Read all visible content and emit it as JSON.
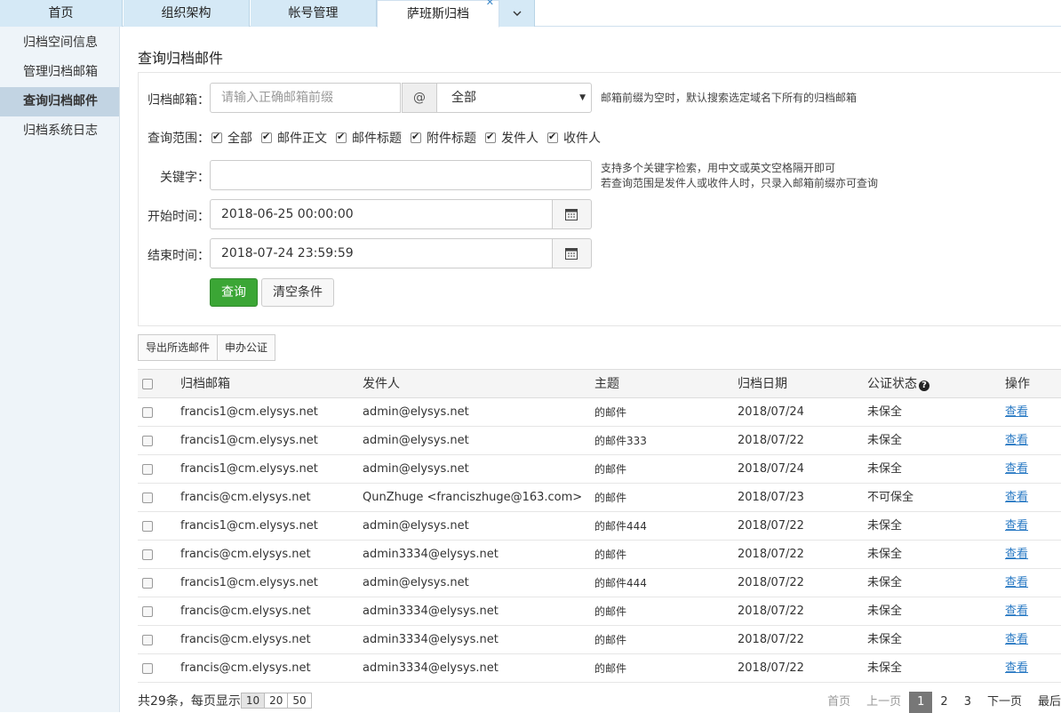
{
  "tabs": [
    {
      "label": "首页"
    },
    {
      "label": "组织架构"
    },
    {
      "label": "帐号管理"
    },
    {
      "label": "萨班斯归档"
    }
  ],
  "sidebar": {
    "items": [
      {
        "label": "归档空间信息"
      },
      {
        "label": "管理归档邮箱"
      },
      {
        "label": "查询归档邮件"
      },
      {
        "label": "归档系统日志"
      }
    ]
  },
  "page_title": "查询归档邮件",
  "form": {
    "mailbox_label": "归档邮箱：",
    "mailbox_placeholder": "请输入正确邮箱前缀",
    "at_symbol": "@",
    "domain_selected": "全部",
    "mailbox_hint": "邮箱前缀为空时，默认搜索选定域名下所有的归档邮箱",
    "scope_label": "查询范围：",
    "scope_options": [
      {
        "label": "全部",
        "checked": true
      },
      {
        "label": "邮件正文",
        "checked": true
      },
      {
        "label": "邮件标题",
        "checked": true
      },
      {
        "label": "附件标题",
        "checked": true
      },
      {
        "label": "发件人",
        "checked": true
      },
      {
        "label": "收件人",
        "checked": true
      }
    ],
    "keyword_label": "关键字：",
    "keyword_value": "",
    "keyword_hint_1": "支持多个关键字检索，用中文或英文空格隔开即可",
    "keyword_hint_2": "若查询范围是发件人或收件人时，只录入邮箱前缀亦可查询",
    "start_label": "开始时间：",
    "start_value": "2018-06-25 00:00:00",
    "end_label": "结束时间：",
    "end_value": "2018-07-24 23:59:59",
    "query_button": "查询",
    "clear_button": "清空条件"
  },
  "actions": {
    "export_button": "导出所选邮件",
    "notarize_button": "申办公证"
  },
  "table": {
    "headers": {
      "mailbox": "归档邮箱",
      "sender": "发件人",
      "subject": "主题",
      "date": "归档日期",
      "status": "公证状态",
      "op": "操作"
    },
    "rows": [
      {
        "mailbox": "francis1@cm.elysys.net",
        "sender": "admin@elysys.net",
        "subject": "的邮件",
        "date": "2018/07/24",
        "status": "未保全",
        "op": "查看"
      },
      {
        "mailbox": "francis1@cm.elysys.net",
        "sender": "admin@elysys.net",
        "subject": "的邮件333",
        "date": "2018/07/22",
        "status": "未保全",
        "op": "查看"
      },
      {
        "mailbox": "francis1@cm.elysys.net",
        "sender": "admin@elysys.net",
        "subject": "的邮件",
        "date": "2018/07/24",
        "status": "未保全",
        "op": "查看"
      },
      {
        "mailbox": "francis@cm.elysys.net",
        "sender": "QunZhuge <franciszhuge@163.com>",
        "subject": "的邮件",
        "date": "2018/07/23",
        "status": "不可保全",
        "op": "查看"
      },
      {
        "mailbox": "francis1@cm.elysys.net",
        "sender": "admin@elysys.net",
        "subject": "的邮件444",
        "date": "2018/07/22",
        "status": "未保全",
        "op": "查看"
      },
      {
        "mailbox": "francis@cm.elysys.net",
        "sender": "admin3334@elysys.net",
        "subject": "的邮件",
        "date": "2018/07/22",
        "status": "未保全",
        "op": "查看"
      },
      {
        "mailbox": "francis1@cm.elysys.net",
        "sender": "admin@elysys.net",
        "subject": "的邮件444",
        "date": "2018/07/22",
        "status": "未保全",
        "op": "查看"
      },
      {
        "mailbox": "francis@cm.elysys.net",
        "sender": "admin3334@elysys.net",
        "subject": "的邮件",
        "date": "2018/07/22",
        "status": "未保全",
        "op": "查看"
      },
      {
        "mailbox": "francis@cm.elysys.net",
        "sender": "admin3334@elysys.net",
        "subject": "的邮件",
        "date": "2018/07/22",
        "status": "未保全",
        "op": "查看"
      },
      {
        "mailbox": "francis@cm.elysys.net",
        "sender": "admin3334@elysys.net",
        "subject": "的邮件",
        "date": "2018/07/22",
        "status": "未保全",
        "op": "查看"
      }
    ]
  },
  "footer": {
    "total_text": "共29条，每页显示",
    "page_sizes": [
      "10",
      "20",
      "50"
    ],
    "first": "首页",
    "prev": "上一页",
    "pages": [
      "1",
      "2",
      "3"
    ],
    "next": "下一页",
    "last": "最后"
  },
  "colors": {
    "primary_green": "#3ba635",
    "link_blue": "#2a7ac4",
    "tab_bg": "#d5e9f6"
  }
}
